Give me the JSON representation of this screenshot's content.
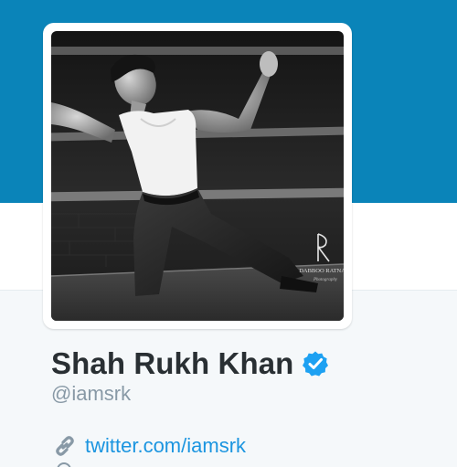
{
  "colors": {
    "banner": "#0a84b9",
    "name": "#292f33",
    "handle": "#8899a6",
    "link": "#1b95e0",
    "verified": "#1da1f2"
  },
  "profile": {
    "display_name": "Shah Rukh Khan",
    "screen_name": "@iamsrk",
    "verified_icon": "verified-badge-icon",
    "url_icon": "link-icon",
    "url_text": "twitter.com/iamsrk",
    "photo_watermark": "DABBOO RATNANI Photography"
  }
}
